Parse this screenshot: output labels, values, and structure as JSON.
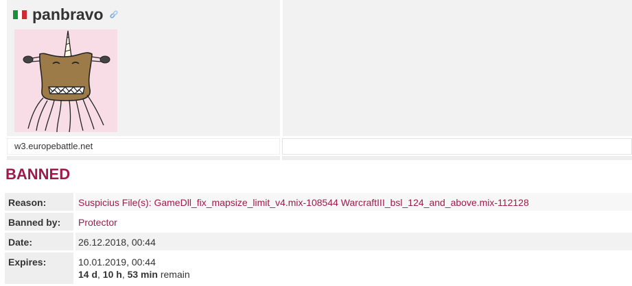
{
  "profile": {
    "username": "panbravo",
    "flag_colors": [
      "#1a8f3c",
      "#ffffff",
      "#ce2b37"
    ],
    "link_icon": "link-icon",
    "server": "w3.europebattle.net"
  },
  "ban": {
    "heading": "BANNED",
    "accent_color": "#a0194b",
    "reason_label": "Reason:",
    "reason_value": "Suspicius File(s): GameDll_fix_mapsize_limit_v4.mix-108544 WarcraftIII_bsl_124_and_above.mix-112128",
    "banned_by_label": "Banned by:",
    "banned_by_value": "Protector",
    "date_label": "Date:",
    "date_value": "26.12.2018, 00:44",
    "expires_label": "Expires:",
    "expires_value": "10.01.2019, 00:44",
    "remain": {
      "days": "14 d",
      "sep1": ", ",
      "hours": "10 h",
      "sep2": ", ",
      "minutes": "53 min",
      "suffix": " remain"
    }
  }
}
